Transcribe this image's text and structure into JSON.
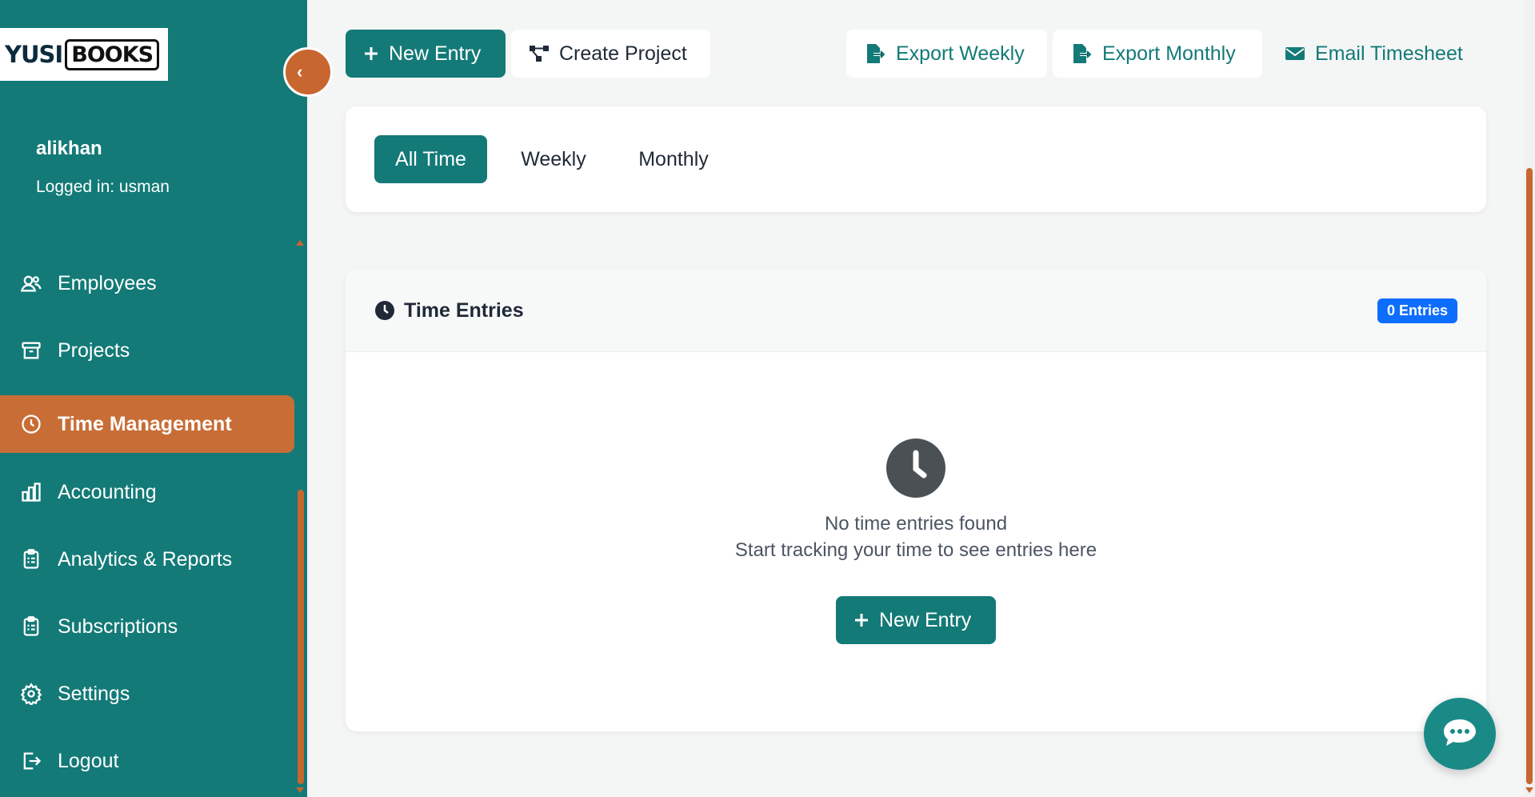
{
  "brand": {
    "logo_left": "YUSI",
    "logo_right": "BOOKS"
  },
  "user": {
    "name": "alikhan",
    "logged_in": "Logged in: usman"
  },
  "sidebar": {
    "items": [
      {
        "label": "Employees",
        "icon": "employees-icon"
      },
      {
        "label": "Projects",
        "icon": "archive-icon"
      },
      {
        "label": "Time Management",
        "icon": "clock-icon",
        "active": true
      },
      {
        "label": "Accounting",
        "icon": "bar-chart-icon"
      },
      {
        "label": "Analytics & Reports",
        "icon": "clipboard-icon"
      },
      {
        "label": "Subscriptions",
        "icon": "clipboard-icon"
      },
      {
        "label": "Settings",
        "icon": "gear-icon"
      },
      {
        "label": "Logout",
        "icon": "logout-icon"
      }
    ]
  },
  "toolbar": {
    "new_entry": "New Entry",
    "create_project": "Create Project",
    "export_weekly": "Export Weekly",
    "export_monthly": "Export Monthly",
    "email_timesheet": "Email Timesheet"
  },
  "filters": {
    "tabs": [
      "All Time",
      "Weekly",
      "Monthly"
    ],
    "active": "All Time"
  },
  "entries": {
    "title": "Time Entries",
    "badge": "0 Entries",
    "empty_title": "No time entries found",
    "empty_subtitle": "Start tracking your time to see entries here",
    "new_entry": "New Entry"
  },
  "colors": {
    "primary": "#137a77",
    "accent": "#c86d35",
    "badge": "#0d6efd"
  }
}
